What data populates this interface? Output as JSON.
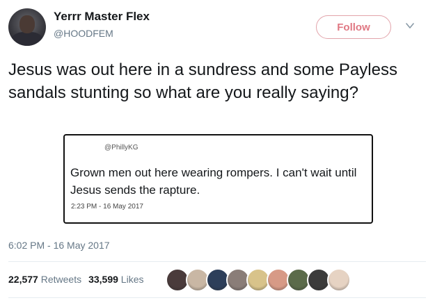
{
  "author": {
    "display_name": "Yerrr Master Flex",
    "handle": "@HOODFEM"
  },
  "actions": {
    "follow_label": "Follow",
    "more_icon": "chevron-down-icon"
  },
  "tweet": {
    "text": "Jesus was out here in a sundress and some Payless sandals stunting so what are you really saying?",
    "timestamp": "6:02 PM - 16 May 2017"
  },
  "quoted": {
    "handle": "@PhillyKG",
    "text": "Grown men out here wearing rompers. I can't wait until Jesus sends the rapture.",
    "timestamp": "2:23 PM - 16 May 2017"
  },
  "stats": {
    "retweets_count": "22,577",
    "retweets_label": "Retweets",
    "likes_count": "33,599",
    "likes_label": "Likes"
  },
  "likers": [
    {
      "color": "#4a3b3b"
    },
    {
      "color": "#c9b7a4"
    },
    {
      "color": "#2d3f5a"
    },
    {
      "color": "#8a7d78"
    },
    {
      "color": "#d8c38a"
    },
    {
      "color": "#d79a86"
    },
    {
      "color": "#5b6b4a"
    },
    {
      "color": "#3b3b3b"
    },
    {
      "color": "#e6d3c3"
    }
  ]
}
